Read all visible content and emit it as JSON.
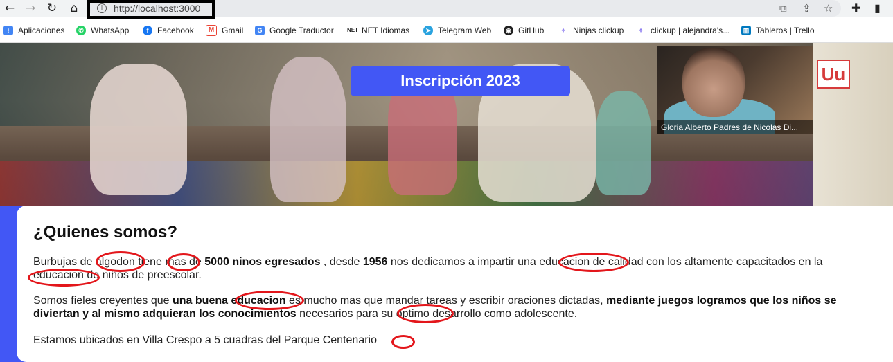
{
  "browser": {
    "url": "http://localhost:3000",
    "bookmarks": [
      {
        "label": "Aplicaciones",
        "color": "#4285f4",
        "glyph": "⋮⋮"
      },
      {
        "label": "WhatsApp",
        "color": "#25d366",
        "glyph": "✆"
      },
      {
        "label": "Facebook",
        "color": "#1877f2",
        "glyph": "f"
      },
      {
        "label": "Gmail",
        "color": "#ea4335",
        "glyph": "M"
      },
      {
        "label": "Google Traductor",
        "color": "#4285f4",
        "glyph": "G"
      },
      {
        "label": "NET Idiomas",
        "color": "#222222",
        "glyph": "N"
      },
      {
        "label": "Telegram Web",
        "color": "#2aa3df",
        "glyph": "➤"
      },
      {
        "label": "GitHub",
        "color": "#222222",
        "glyph": "◉"
      },
      {
        "label": "Ninjas clickup",
        "color": "#7b68ee",
        "glyph": "✧"
      },
      {
        "label": "clickup | alejandra's...",
        "color": "#7b68ee",
        "glyph": "✧"
      },
      {
        "label": "Tableros | Trello",
        "color": "#0079bf",
        "glyph": "▥"
      }
    ]
  },
  "hero": {
    "banner": "Inscripción 2023",
    "video_label": "Gloria Alberto Padres de Nicolas Di...",
    "board_letter": "Uu"
  },
  "content": {
    "heading": "¿Quienes somos?",
    "p1": {
      "a": "Burbujas de algodon tiene mas de ",
      "b1": "5000 ninos egresados",
      "c": " , desde ",
      "b2": "1956",
      "d": " nos dedicamos a impartir una educacion de calidad con los altamente capacitados en la educacion de niños de preescolar."
    },
    "p2": {
      "a": "Somos fieles creyentes que ",
      "b1": "una buena educacion",
      "c": " es mucho mas que mandar tareas y escribir oraciones dictadas, ",
      "b2": "mediante juegos logramos que los niños se diviertan y al mismo adquieran los conocimientos",
      "d": " necesarios para su optimo desarrollo como adolescente."
    },
    "p3": "Estamos ubicados en Villa Crespo a 5 cuadras del Parque Centenario"
  },
  "colors": {
    "accent": "#4257f5",
    "annotation": "#e3161b"
  }
}
